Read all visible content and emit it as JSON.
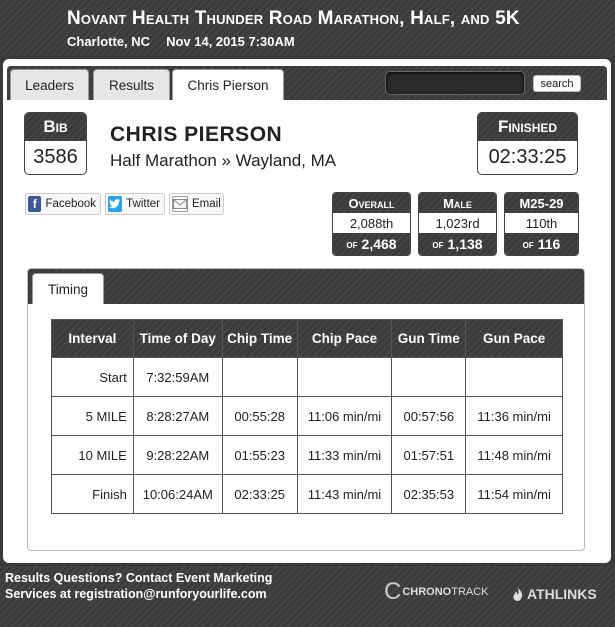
{
  "event": {
    "title": "Novant Health Thunder Road Marathon, Half, and 5K",
    "location": "Charlotte, NC",
    "datetime": "Nov 14, 2015 7:30AM"
  },
  "tabs": [
    {
      "label": "Leaders",
      "active": false
    },
    {
      "label": "Results",
      "active": false
    },
    {
      "label": "Chris Pierson",
      "active": true
    }
  ],
  "search": {
    "button_label": "search",
    "value": ""
  },
  "runner": {
    "bib_label": "Bib",
    "bib": "3586",
    "name": "CHRIS PIERSON",
    "race_line": "Half Marathon » Wayland, MA",
    "finished_label": "Finished",
    "finish_time": "02:33:25"
  },
  "share": [
    {
      "label": "Facebook",
      "icon": "facebook-icon"
    },
    {
      "label": "Twitter",
      "icon": "twitter-icon"
    },
    {
      "label": "Email",
      "icon": "email-icon"
    }
  ],
  "ranks": [
    {
      "label": "Overall",
      "place": "2,088th",
      "of_label": "of",
      "total": "2,468"
    },
    {
      "label": "Male",
      "place": "1,023rd",
      "of_label": "of",
      "total": "1,138"
    },
    {
      "label": "M25-29",
      "place": "110th",
      "of_label": "of",
      "total": "116"
    }
  ],
  "timing": {
    "tab_label": "Timing",
    "headers": [
      "Interval",
      "Time of Day",
      "Chip Time",
      "Chip Pace",
      "Gun Time",
      "Gun Pace"
    ],
    "rows": [
      {
        "interval": "Start",
        "tod": "7:32:59AM",
        "chip_time": "",
        "chip_pace": "",
        "gun_time": "",
        "gun_pace": ""
      },
      {
        "interval": "5 MILE",
        "tod": "8:28:27AM",
        "chip_time": "00:55:28",
        "chip_pace": "11:06 min/mi",
        "gun_time": "00:57:56",
        "gun_pace": "11:36 min/mi"
      },
      {
        "interval": "10 MILE",
        "tod": "9:28:22AM",
        "chip_time": "01:55:23",
        "chip_pace": "11:33 min/mi",
        "gun_time": "01:57:51",
        "gun_pace": "11:48 min/mi"
      },
      {
        "interval": "Finish",
        "tod": "10:06:24AM",
        "chip_time": "02:33:25",
        "chip_pace": "11:43 min/mi",
        "gun_time": "02:35:53",
        "gun_pace": "11:54 min/mi"
      }
    ]
  },
  "footer": {
    "contact_line1": "Results Questions? Contact Event Marketing",
    "contact_line2": "Services at registration@runforyourlife.com",
    "chrono_brand_a": "CHRONO",
    "chrono_brand_b": "TRACK",
    "athlinks_brand": "ATHLINKS"
  },
  "colors": {
    "header_bg": "#3b3b3b",
    "panel_bg": "#ffffff",
    "facebook": "#3b5998",
    "twitter": "#2aa3ef"
  }
}
